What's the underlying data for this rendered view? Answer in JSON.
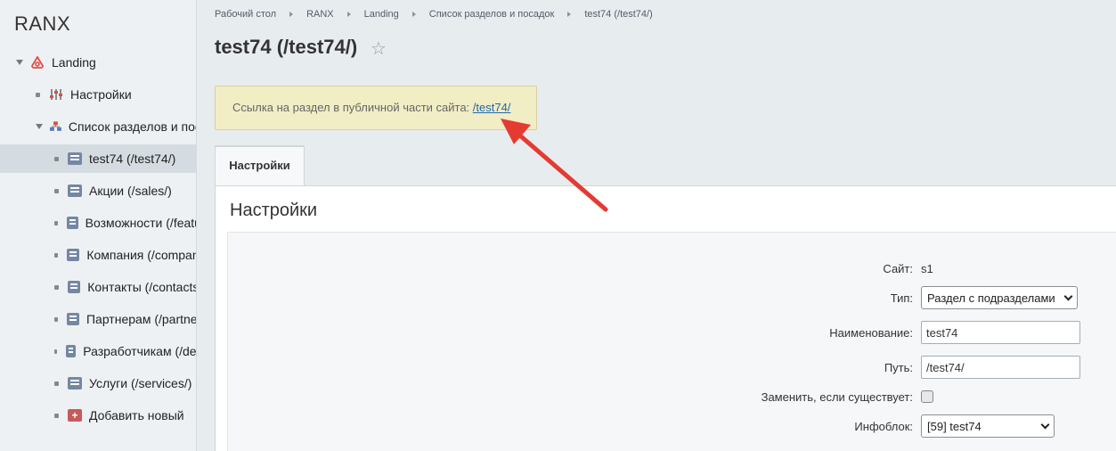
{
  "app": {
    "brand": "RANX"
  },
  "sidebar": {
    "items": [
      {
        "label": "Landing",
        "icon": "landing-logo-icon"
      },
      {
        "label": "Настройки",
        "icon": "sliders-icon"
      },
      {
        "label": "Список разделов и посадок",
        "icon": "sitemap-icon"
      },
      {
        "label": "test74 (/test74/)",
        "icon": "page-icon"
      },
      {
        "label": "Акции (/sales/)",
        "icon": "page-icon"
      },
      {
        "label": "Возможности (/features/)",
        "icon": "page-icon"
      },
      {
        "label": "Компания (/company/)",
        "icon": "page-icon"
      },
      {
        "label": "Контакты (/contacts/)",
        "icon": "page-icon"
      },
      {
        "label": "Партнерам (/partners/)",
        "icon": "page-icon"
      },
      {
        "label": "Разработчикам (/developers/)",
        "icon": "page-icon"
      },
      {
        "label": "Услуги (/services/)",
        "icon": "page-icon"
      },
      {
        "label": "Добавить новый",
        "icon": "add-icon"
      }
    ]
  },
  "breadcrumbs": [
    "Рабочий стол",
    "RANX",
    "Landing",
    "Список разделов и посадок",
    "test74 (/test74/)"
  ],
  "page": {
    "title": "test74 (/test74/)"
  },
  "notice": {
    "text": "Ссылка на раздел в публичной части сайта: ",
    "link": "/test74/"
  },
  "tabs": [
    {
      "label": "Настройки"
    }
  ],
  "panel": {
    "title": "Настройки"
  },
  "form": {
    "site_label": "Сайт:",
    "site_value": "s1",
    "type_label": "Тип:",
    "type_value": "Раздел с подразделами",
    "name_label": "Наименование:",
    "name_value": "test74",
    "path_label": "Путь:",
    "path_value": "/test74/",
    "replace_label": "Заменить, если существует:",
    "replace_checked": false,
    "iblock_label": "Инфоблок:",
    "iblock_value": "[59] test74"
  },
  "colors": {
    "arrow": "#e53a32",
    "link": "#2067b0",
    "notice_bg": "#f1edc4"
  }
}
